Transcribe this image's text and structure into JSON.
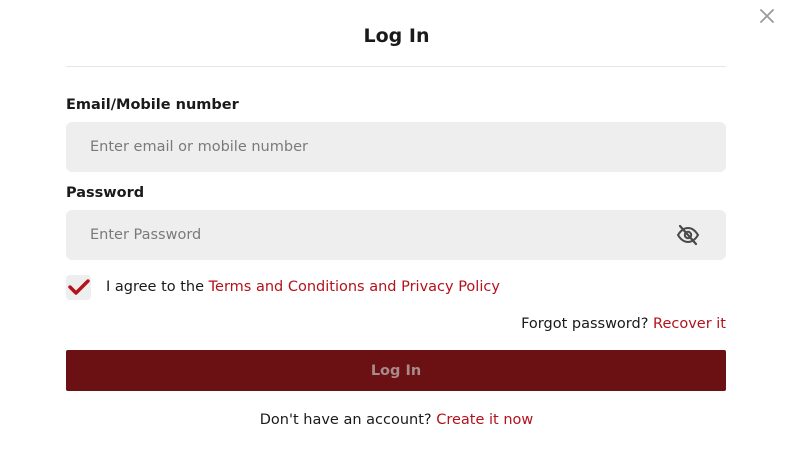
{
  "modal": {
    "title": "Log In",
    "close_icon": "close-icon"
  },
  "email": {
    "label": "Email/Mobile number",
    "placeholder": "Enter email or mobile number",
    "value": ""
  },
  "password": {
    "label": "Password",
    "placeholder": "Enter Password",
    "value": "",
    "toggle_icon": "eye-off-icon"
  },
  "agreement": {
    "checked": true,
    "text": "I agree to the ",
    "link_text": "Terms and Conditions and Privacy Policy",
    "check_icon": "checkmark-icon"
  },
  "forgot": {
    "text": "Forgot password? ",
    "link_text": "Recover it"
  },
  "submit": {
    "label": "Log In"
  },
  "signup": {
    "text": "Don't have an account? ",
    "link_text": "Create it now"
  },
  "colors": {
    "accent": "#b3121b",
    "button_bg": "#6b1013",
    "button_text": "#a98a8b",
    "input_bg": "#eeeeee",
    "check": "#b3121b"
  }
}
